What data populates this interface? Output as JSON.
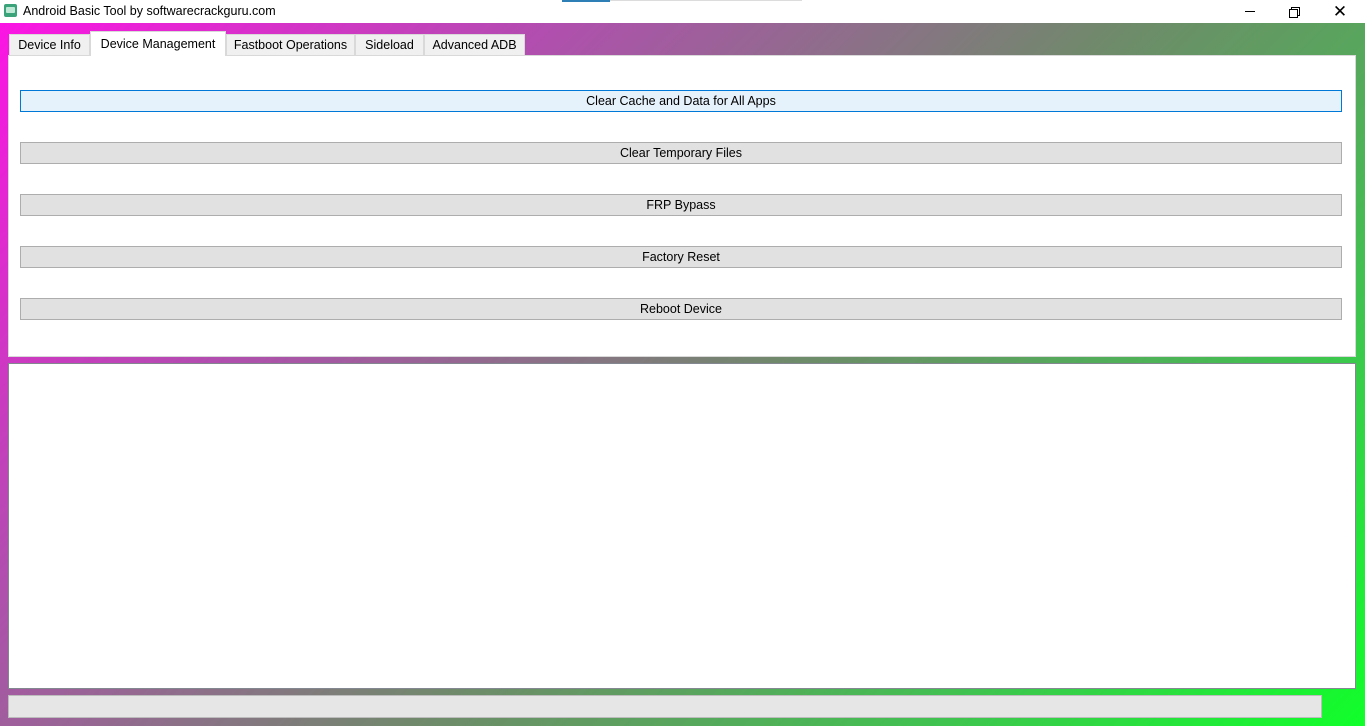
{
  "window": {
    "title": "Android Basic Tool by softwarecrackguru.com",
    "icon": "android-app-icon",
    "controls": {
      "minimize": "minimize-icon",
      "restore": "restore-icon",
      "close": "close-icon",
      "close_glyph": "✕"
    }
  },
  "tabs": [
    {
      "label": "Device Info",
      "active": false
    },
    {
      "label": "Device Management",
      "active": true
    },
    {
      "label": "Fastboot Operations",
      "active": false
    },
    {
      "label": "Sideload",
      "active": false
    },
    {
      "label": "Advanced ADB",
      "active": false
    }
  ],
  "device_management": {
    "buttons": [
      {
        "label": "Clear Cache and Data for All Apps",
        "focused": true
      },
      {
        "label": "Clear Temporary Files",
        "focused": false
      },
      {
        "label": "FRP Bypass",
        "focused": false
      },
      {
        "label": "Factory Reset",
        "focused": false
      },
      {
        "label": "Reboot Device",
        "focused": false
      }
    ]
  },
  "log_output": {
    "text": ""
  },
  "progress": {
    "value": 0
  },
  "colors": {
    "gradient_start": "#ff12e6",
    "gradient_end": "#10ff2a",
    "focus_border": "#0078d7",
    "button_face": "#e1e1e1"
  }
}
